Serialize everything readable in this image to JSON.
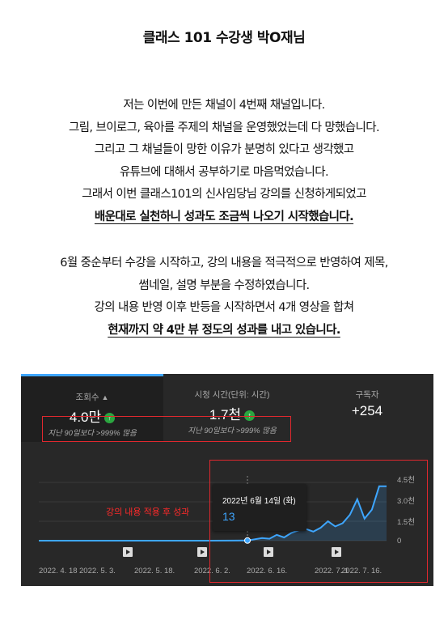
{
  "header": {
    "title": "클래스 101 수강생 박O재님"
  },
  "intro_lines": [
    "저는 이번에 만든 채널이 4번째 채널입니다.",
    "그림, 브이로그, 육아를 주제의 채널을 운영했었는데 다 망했습니다.",
    "그리고 그 채널들이 망한 이유가 분명히 있다고 생각했고",
    "유튜브에 대해서 공부하기로 마음먹었습니다.",
    "그래서 이번 클래스101의 신사임당님 강의를 신청하게되었고"
  ],
  "intro_emphasis": "배운대로 실천하니 성과도 조금씩 나오기 시작했습니다.",
  "result_lines": [
    "6월 중순부터 수강을 시작하고, 강의 내용을 적극적으로 반영하여 제목,",
    "썸네일, 설명 부분을 수정하였습니다.",
    "강의 내용 반영 이후 반등을 시작하면서 4개 영상을 합쳐"
  ],
  "result_emphasis": "현재까지 약 4만 뷰 정도의 성과를 내고 있습니다.",
  "analytics": {
    "tabs": [
      {
        "label": "조회수",
        "value": "4.0만",
        "note": "지난 90일보다 >999% 많음",
        "warn_icon": "warning-triangle-icon",
        "trend_icon": "arrow-up-icon"
      },
      {
        "label": "시청 시간(단위: 시간)",
        "value": "1.7천",
        "note": "지난 90일보다 >999% 많음",
        "trend_icon": "arrow-up-icon"
      },
      {
        "label": "구독자",
        "value": "+254"
      }
    ],
    "tooltip": {
      "date": "2022년 6월 14일 (화)",
      "value": "13"
    },
    "annotation": "강의 내용 적용 후 성과",
    "colors": {
      "accent": "#3ea6ff",
      "panel": "#282828",
      "highlight_box": "#e0282e",
      "annotation": "#ff2a2a",
      "up": "#2ba640"
    }
  },
  "chart_data": {
    "type": "area",
    "x_tick_labels": [
      "2022. 4. 18",
      "2022. 5. 3.",
      "2022. 5. 18.",
      "2022. 6. 2.",
      "2022. 6. 16.",
      "2022. 7. 1",
      "2022. 7. 16."
    ],
    "y_tick_labels": [
      "4.5천",
      "3.0천",
      "1.5천",
      "0"
    ],
    "ylim": [
      0,
      4500
    ],
    "grid": true,
    "series": [
      {
        "x": [
          "2022-04-18",
          "2022-05-03",
          "2022-05-18",
          "2022-06-02",
          "2022-06-10",
          "2022-06-14",
          "2022-06-18",
          "2022-06-20",
          "2022-06-22",
          "2022-06-24",
          "2022-06-26",
          "2022-06-28",
          "2022-06-30",
          "2022-07-02",
          "2022-07-04",
          "2022-07-06",
          "2022-07-08",
          "2022-07-10",
          "2022-07-12",
          "2022-07-14",
          "2022-07-16",
          "2022-07-18",
          "2022-07-20",
          "2022-07-22"
        ],
        "values": [
          0,
          0,
          0,
          0,
          5,
          13,
          200,
          150,
          450,
          250,
          600,
          800,
          900,
          700,
          1000,
          1500,
          1100,
          1350,
          2000,
          3200,
          1700,
          2400,
          4200,
          4200
        ]
      }
    ],
    "video_markers": [
      "2022-05-03",
      "2022-05-24",
      "2022-06-17",
      "2022-07-09"
    ]
  }
}
